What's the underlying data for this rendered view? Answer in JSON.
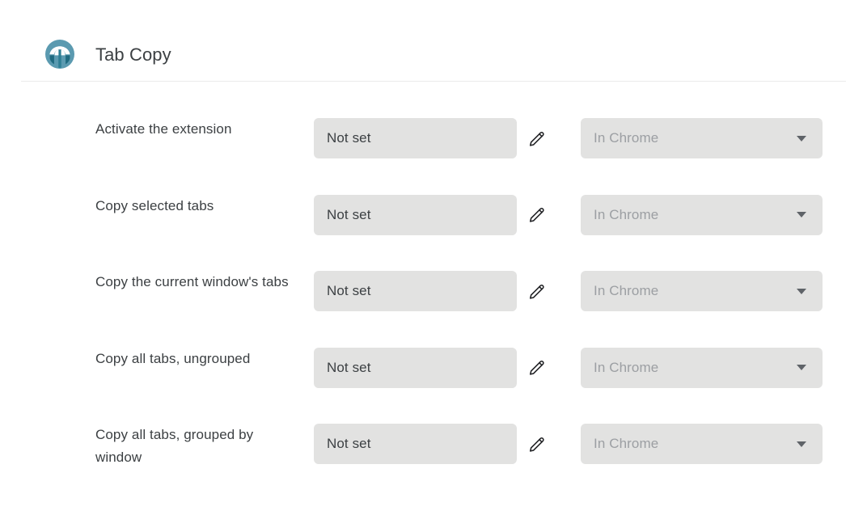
{
  "header": {
    "logo_icon": "tab-copy-logo-icon",
    "title": "Tab Copy",
    "logo_colors": {
      "light": "#5b9ab0",
      "dark": "#1f6a80"
    }
  },
  "colors": {
    "field_background": "#e2e2e1",
    "text_primary": "#3c4043",
    "text_disabled": "#9c9fa3",
    "divider": "#ebebeb",
    "page_background": "#ffffff"
  },
  "commands": [
    {
      "label": "Activate the extension",
      "shortcut": "Not set",
      "edit_icon": "pencil-icon",
      "scope": "In Chrome",
      "scope_caret_icon": "chevron-down-icon"
    },
    {
      "label": "Copy selected tabs",
      "shortcut": "Not set",
      "edit_icon": "pencil-icon",
      "scope": "In Chrome",
      "scope_caret_icon": "chevron-down-icon"
    },
    {
      "label": "Copy the current window's tabs",
      "shortcut": "Not set",
      "edit_icon": "pencil-icon",
      "scope": "In Chrome",
      "scope_caret_icon": "chevron-down-icon"
    },
    {
      "label": "Copy all tabs, ungrouped",
      "shortcut": "Not set",
      "edit_icon": "pencil-icon",
      "scope": "In Chrome",
      "scope_caret_icon": "chevron-down-icon"
    },
    {
      "label": "Copy all tabs, grouped by window",
      "shortcut": "Not set",
      "edit_icon": "pencil-icon",
      "scope": "In Chrome",
      "scope_caret_icon": "chevron-down-icon"
    }
  ]
}
